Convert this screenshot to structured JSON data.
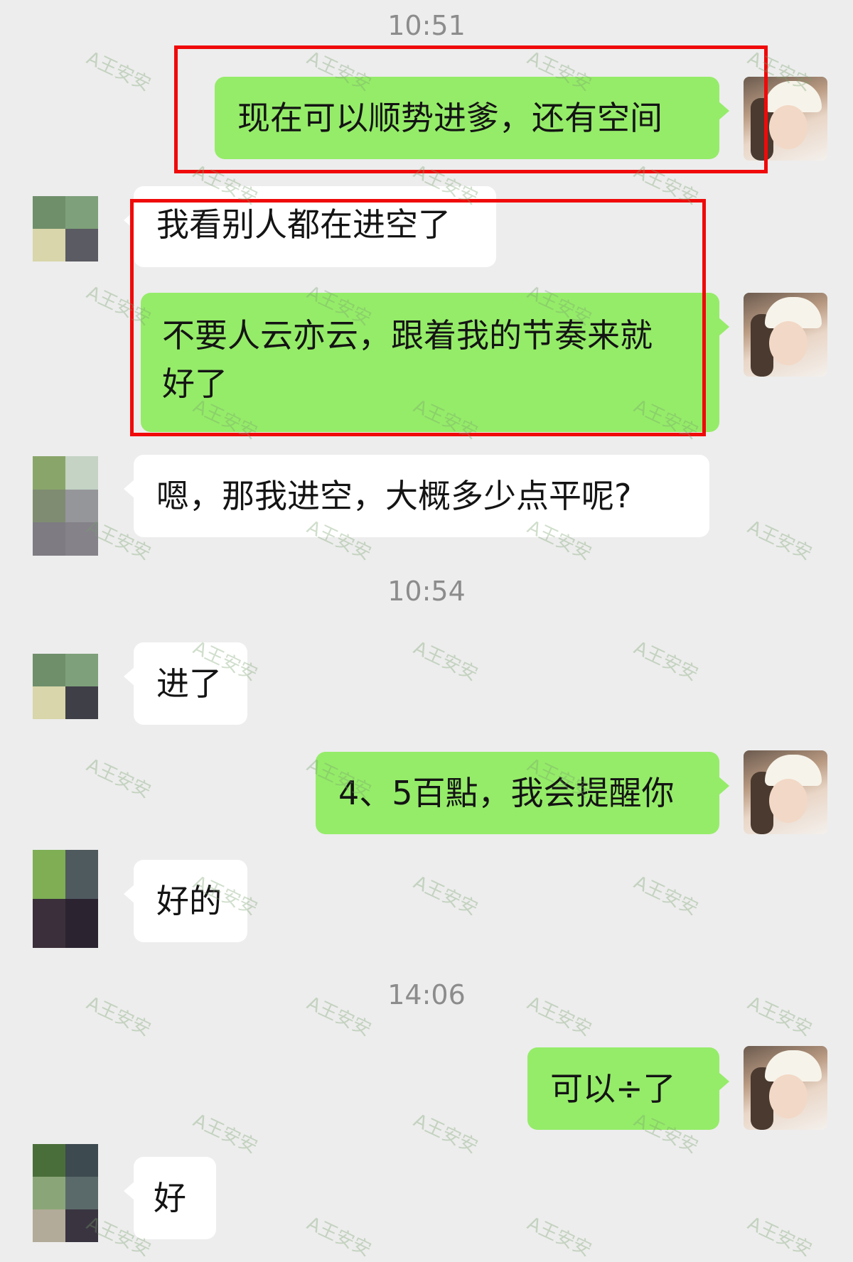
{
  "watermark": "A王安安",
  "colors": {
    "background": "#ededed",
    "sent_bubble": "#95ec69",
    "received_bubble": "#ffffff",
    "highlight_box": "#f00a0a"
  },
  "timestamps": [
    "10:51",
    "10:54",
    "14:06"
  ],
  "messages": [
    {
      "side": "sent",
      "lines": [
        "现在可以顺势进爹，还有空间"
      ]
    },
    {
      "side": "received",
      "lines": [
        "我看别人都在进空了"
      ]
    },
    {
      "side": "sent",
      "lines": [
        "不要人云亦云，跟着我的节奏来就",
        "好了"
      ]
    },
    {
      "side": "received",
      "lines": [
        "嗯，那我进空，大概多少点平呢?"
      ]
    },
    {
      "side": "received",
      "lines": [
        "进了"
      ]
    },
    {
      "side": "sent",
      "lines": [
        "4、5百點，我会提醒你"
      ]
    },
    {
      "side": "received",
      "lines": [
        "好的"
      ]
    },
    {
      "side": "sent",
      "lines": [
        "可以÷了"
      ]
    },
    {
      "side": "received",
      "lines": [
        "好"
      ]
    }
  ]
}
